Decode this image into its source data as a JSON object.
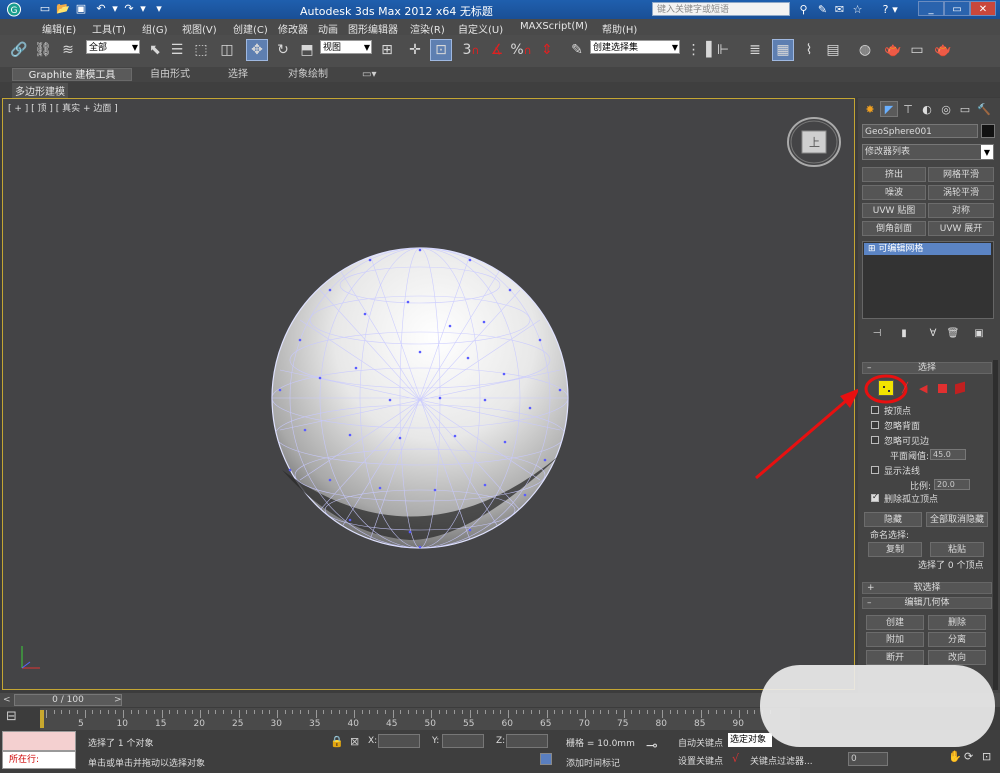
{
  "titlebar": {
    "title": "Autodesk 3ds Max  2012 x64      无标题",
    "search_placeholder": "键入关键字或短语",
    "win_buttons": [
      "_",
      "▭",
      "✕"
    ]
  },
  "menubar": {
    "items": [
      "编辑(E)",
      "工具(T)",
      "组(G)",
      "视图(V)",
      "创建(C)",
      "修改器",
      "动画",
      "图形编辑器",
      "渲染(R)",
      "自定义(U)",
      "MAXScript(M)",
      "帮助(H)"
    ]
  },
  "toolbar": {
    "selection_filter": "全部",
    "ref_coord": "视图",
    "named_selection": "创建选择集",
    "snap_label": "3",
    "percent_label": "%"
  },
  "ribbon": {
    "tabs": [
      "Graphite 建模工具",
      "自由形式",
      "选择",
      "对象绘制"
    ],
    "sub_tab": "多边形建模"
  },
  "viewport": {
    "label": "[ + ] [ 顶 ] [ 真实 + 边面 ]",
    "viewcube_label": "上"
  },
  "command_panel": {
    "object_name": "GeoSphere001",
    "modifier_list": "修改器列表",
    "modifier_buttons": [
      "挤出",
      "网格平滑",
      "噪波",
      "涡轮平滑",
      "UVW 贴图",
      "对称",
      "倒角剖面",
      "UVW 展开"
    ],
    "stack_item": "可编辑网格",
    "selection_rollout": "选择",
    "by_vertex": "按顶点",
    "ignore_backfacing": "忽略背面",
    "ignore_visible_edges": "忽略可见边",
    "planar_threshold_label": "平面阈值:",
    "planar_threshold_value": "45.0",
    "show_normals": "显示法线",
    "scale_label": "比例:",
    "scale_value": "20.0",
    "delete_isolated": "删除孤立顶点",
    "hide": "隐藏",
    "unhide_all": "全部取消隐藏",
    "named_selections": "命名选择:",
    "copy": "复制",
    "paste": "粘贴",
    "selected_count": "选择了 0 个顶点",
    "soft_selection": "软选择",
    "edit_geometry": "编辑几何体",
    "create": "创建",
    "delete": "删除",
    "attach": "附加",
    "detach": "分离",
    "break": "断开",
    "turn": "改向"
  },
  "timeline": {
    "frame": "0 / 100",
    "ticks": [
      "5",
      "10",
      "15",
      "20",
      "25",
      "30",
      "35",
      "40",
      "45",
      "50",
      "55",
      "60",
      "65",
      "70",
      "75",
      "80",
      "85",
      "90"
    ]
  },
  "status": {
    "maxscript_label": "所在行:",
    "selected_objects": "选择了 1 个对象",
    "prompt": "单击或单击并拖动以选择对象",
    "x_label": "X:",
    "y_label": "Y:",
    "z_label": "Z:",
    "grid": "栅格 = 10.0mm",
    "auto_key": "自动关键点",
    "selected_object": "选定对象",
    "set_key": "设置关键点",
    "key_filter": "关键点过滤器...",
    "add_time_tag": "添加时间标记",
    "frame_value": "0"
  },
  "colors": {
    "highlight_circle": "#e81010",
    "vertex_button": "#f2e400",
    "viewport_border": "#c4a633"
  }
}
